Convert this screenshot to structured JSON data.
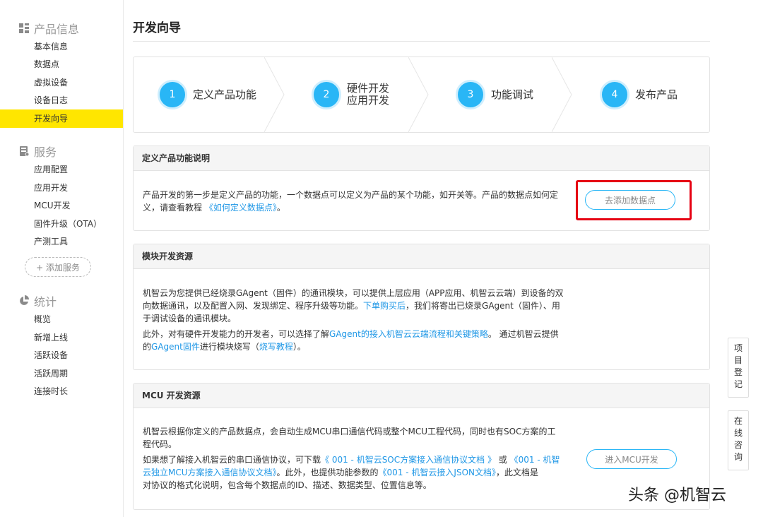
{
  "sidebar": {
    "product_info": "产品信息",
    "product_items": [
      "基本信息",
      "数据点",
      "虚拟设备",
      "设备日志",
      "开发向导"
    ],
    "service": "服务",
    "service_items": [
      "应用配置",
      "应用开发",
      "MCU开发",
      "固件升级（OTA）",
      "产测工具"
    ],
    "add_service": "+ 添加服务",
    "stats": "统计",
    "stats_items": [
      "概览",
      "新增上线",
      "活跃设备",
      "活跃周期",
      "连接时长"
    ]
  },
  "page_title": "开发向导",
  "steps": [
    {
      "num": "1",
      "label": "定义产品功能"
    },
    {
      "num": "2",
      "label_line1": "硬件开发",
      "label_line2": "应用开发"
    },
    {
      "num": "3",
      "label": "功能调试"
    },
    {
      "num": "4",
      "label": "发布产品"
    }
  ],
  "panel1": {
    "title": "定义产品功能说明",
    "line1": "产品开发的第一步是定义产品的功能，一个数据点可以定义为产品的某个功能，如开关等。产品的数据点如何定",
    "line2_prefix": "义，请查看教程",
    "line2_link": "《如何定义数据点》",
    "line2_suffix": "。",
    "button": "去添加数据点"
  },
  "panel2": {
    "title": "模块开发资源",
    "p1_l1": "机智云为您提供已经烧录GAgent（固件）的通讯模块，可以提供上层应用（APP应用、机智云云端）到设备的双",
    "p1_l2_a": "向数据通讯，以及配置入网、发现绑定、程序升级等功能。",
    "p1_l2_link": "下单购买后",
    "p1_l2_b": "，我们将寄出已烧录GAgent（固件）、用",
    "p1_l3": "于调试设备的通讯模块。",
    "p2_l1_a": "此外，对有硬件开发能力的开发者，可以选择了解",
    "p2_l1_link": "GAgent的接入机智云云端流程和关键策略",
    "p2_l1_b": "。 通过机智云提供",
    "p2_l2_pre": "的",
    "p2_l2_link1": "GAgent固件",
    "p2_l2_mid": "进行模块烧写（",
    "p2_l2_link2": "烧写教程",
    "p2_l2_end": "）。"
  },
  "panel3": {
    "title": "MCU 开发资源",
    "p1_l1": "机智云根据你定义的产品数据点，会自动生成MCU串口通信代码或整个MCU工程代码，同时也有SOC方案的工",
    "p1_l2": "程代码。",
    "p2_l1_a": "如果想了解接入机智云的串口通信协议，可下载",
    "p2_l1_link1": "《 001 - 机智云SOC方案接入通信协议文档 》",
    "p2_l1_b": " 或 ",
    "p2_l1_link2": "《001 - 机智",
    "p2_l2_link2b": "云独立MCU方案接入通信协议文档》",
    "p2_l2_a": "。此外，也提供功能参数的",
    "p2_l2_link3": "《001 - 机智云接入JSON文档》",
    "p2_l2_b": "，此文档是",
    "p2_l3": "对协议的格式化说明，包含每个数据点的ID、描述、数据类型、位置信息等。",
    "button": "进入MCU开发"
  },
  "side_tabs": {
    "tab1": "项目登记",
    "tab2": "在线咨询"
  },
  "watermark": "头条 @机智云",
  "colors": {
    "accent": "#29b6f6",
    "active_nav": "#ffe600",
    "link": "#1f97e6",
    "highlight_box": "#e60012"
  }
}
